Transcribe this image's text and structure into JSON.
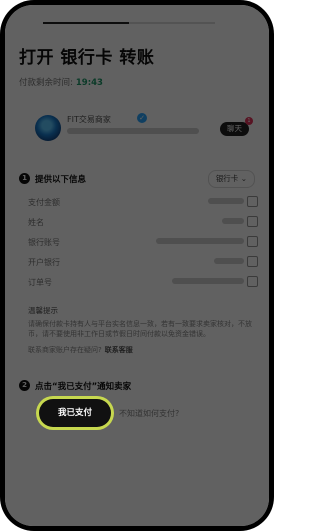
{
  "header": {
    "title": "打开 银行卡 转账",
    "countdown_label": "付款剩余时间:",
    "countdown_value": "19:43",
    "progress_fraction": 0.5
  },
  "merchant": {
    "name": "FIT交易商家",
    "follow_label": "聊天",
    "badge": "1"
  },
  "step1": {
    "number": "1",
    "title": "提供以下信息",
    "method": "银行卡",
    "method_caret": "⌄",
    "rows": [
      {
        "label": "支付金额"
      },
      {
        "label": "姓名"
      },
      {
        "label": "银行账号"
      },
      {
        "label": "开户银行"
      },
      {
        "label": "订单号"
      }
    ]
  },
  "notice": {
    "title": "温馨提示",
    "body": "请确保付款卡持有人与平台实名信息一致，若有一致要求卖家核对，不放币，请不要使用非工作日或节假日时间付款以免资金错误。",
    "link_prefix": "联系商家账户存在疑问?",
    "link_text": "联系客服"
  },
  "step2": {
    "number": "2",
    "title": "点击“我已支付”通知卖家",
    "paid_button": "我已支付",
    "help_link": "不知道如何支付?"
  }
}
